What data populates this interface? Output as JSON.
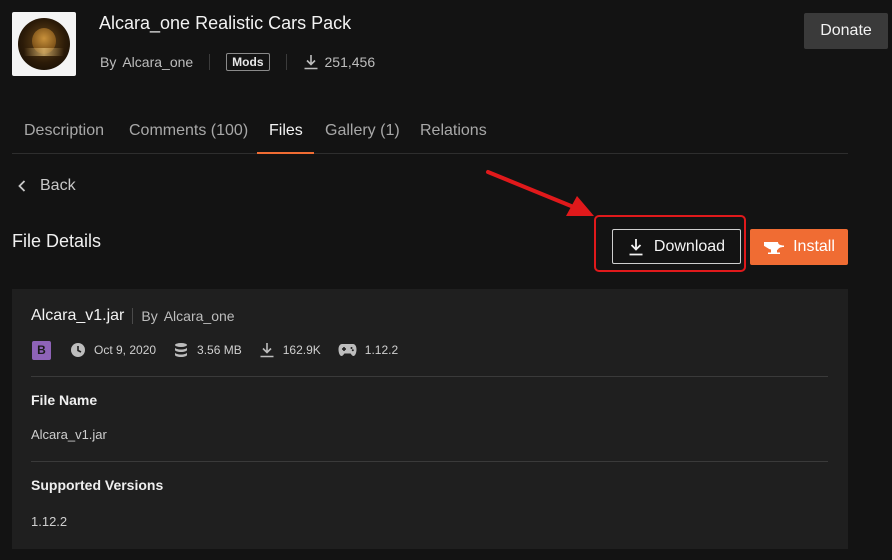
{
  "header": {
    "project_title": "Alcara_one Realistic Cars Pack",
    "by_label": "By",
    "author": "Alcara_one",
    "category_badge": "Mods",
    "download_count": "251,456",
    "donate_label": "Donate"
  },
  "tabs": [
    {
      "label": "Description",
      "active": false
    },
    {
      "label": "Comments (100)",
      "active": false
    },
    {
      "label": "Files",
      "active": true
    },
    {
      "label": "Gallery (1)",
      "active": false
    },
    {
      "label": "Relations",
      "active": false
    }
  ],
  "nav": {
    "back_label": "Back"
  },
  "file_details": {
    "title": "File Details",
    "download_label": "Download",
    "install_label": "Install"
  },
  "file": {
    "name": "Alcara_v1.jar",
    "by_label": "By",
    "author": "Alcara_one",
    "release_badge": "B",
    "date": "Oct 9, 2020",
    "size": "3.56 MB",
    "downloads": "162.9K",
    "game_version": "1.12.2",
    "file_name_label": "File Name",
    "file_name_value": "Alcara_v1.jar",
    "supported_versions_label": "Supported Versions",
    "supported_versions_value": "1.12.2"
  },
  "colors": {
    "accent": "#f06c33",
    "highlight": "#e0191b",
    "beta": "#8e63b7"
  },
  "icons": [
    "download-icon",
    "chevron-left-icon",
    "anvil-icon",
    "clock-icon",
    "database-icon",
    "gamepad-icon",
    "red-arrow-icon"
  ]
}
